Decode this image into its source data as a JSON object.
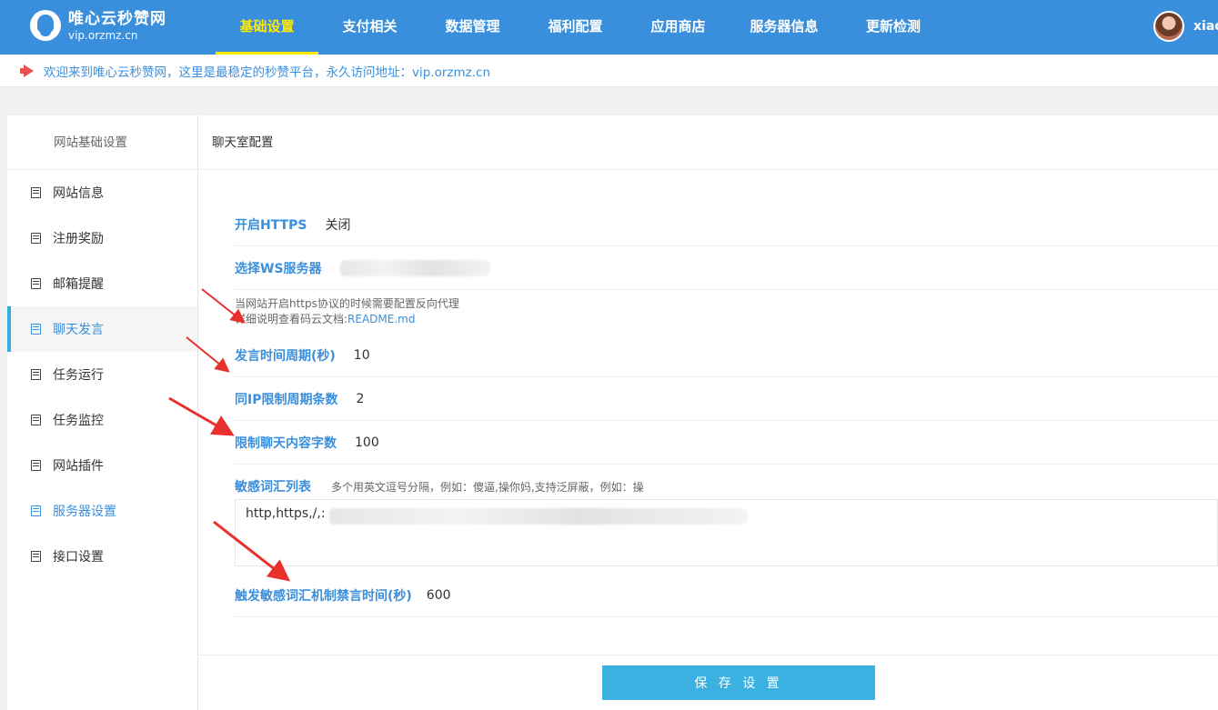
{
  "brand": {
    "name": "唯心云秒赞网",
    "domain": "vip.orzmz.cn"
  },
  "nav": [
    {
      "label": "基础设置",
      "active": true
    },
    {
      "label": "支付相关"
    },
    {
      "label": "数据管理"
    },
    {
      "label": "福利配置"
    },
    {
      "label": "应用商店"
    },
    {
      "label": "服务器信息"
    },
    {
      "label": "更新检测"
    }
  ],
  "user": {
    "name": "xiao"
  },
  "notice": {
    "text": "欢迎来到唯心云秒赞网，这里是最稳定的秒赞平台，永久访问地址：vip.orzmz.cn"
  },
  "sidebar": {
    "title": "网站基础设置",
    "items": [
      {
        "label": "网站信息"
      },
      {
        "label": "注册奖励"
      },
      {
        "label": "邮箱提醒"
      },
      {
        "label": "聊天发言",
        "active": true
      },
      {
        "label": "任务运行"
      },
      {
        "label": "任务监控"
      },
      {
        "label": "网站插件"
      },
      {
        "label": "服务器设置",
        "highlight": true
      },
      {
        "label": "接口设置"
      }
    ]
  },
  "content": {
    "title": "聊天室配置",
    "https": {
      "label": "开启HTTPS",
      "value": "关闭"
    },
    "ws": {
      "label": "选择WS服务器"
    },
    "hint_line1": "当网站开启https协议的时候需要配置反向代理",
    "hint_line2_prefix": "详细说明查看码云文档:",
    "hint_line2_link": "README.md",
    "period": {
      "label": "发言时间周期(秒)",
      "value": "10"
    },
    "ip_limit": {
      "label": "同IP限制周期条数",
      "value": "2"
    },
    "char_limit": {
      "label": "限制聊天内容字数",
      "value": "100"
    },
    "sensitive": {
      "label": "敏感词汇列表",
      "hint": "多个用英文逗号分隔，例如：傻逼,操你妈,支持泛屏蔽，例如：操",
      "value": "http,https,/,:"
    },
    "ban_time": {
      "label": "触发敏感词汇机制禁言时间(秒)",
      "value": "600"
    },
    "save_label": "保 存 设 置"
  },
  "colors": {
    "primary": "#3a8fdc",
    "button": "#3ab1e0",
    "nav_active": "#ffea00",
    "arrow": "#e8302c"
  }
}
